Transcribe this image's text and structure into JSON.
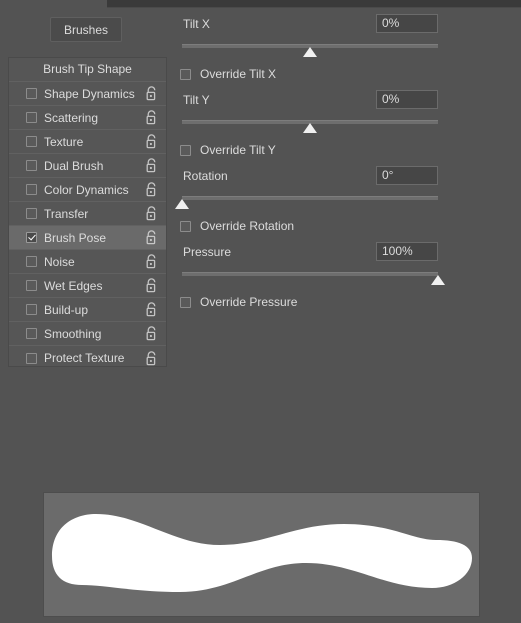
{
  "window": {
    "panel_title": "Brushes"
  },
  "toolbar": {
    "brushes_label": "Brushes"
  },
  "effect_list": {
    "header": "Brush Tip Shape",
    "items": [
      {
        "label": "Shape Dynamics",
        "checked": false,
        "selected": false,
        "lock": "unlocked"
      },
      {
        "label": "Scattering",
        "checked": false,
        "selected": false,
        "lock": "unlocked"
      },
      {
        "label": "Texture",
        "checked": false,
        "selected": false,
        "lock": "unlocked"
      },
      {
        "label": "Dual Brush",
        "checked": false,
        "selected": false,
        "lock": "unlocked"
      },
      {
        "label": "Color Dynamics",
        "checked": false,
        "selected": false,
        "lock": "unlocked"
      },
      {
        "label": "Transfer",
        "checked": false,
        "selected": false,
        "lock": "unlocked"
      },
      {
        "label": "Brush Pose",
        "checked": true,
        "selected": true,
        "lock": "unlocked"
      },
      {
        "label": "Noise",
        "checked": false,
        "selected": false,
        "lock": "unlocked"
      },
      {
        "label": "Wet Edges",
        "checked": false,
        "selected": false,
        "lock": "unlocked"
      },
      {
        "label": "Build-up",
        "checked": false,
        "selected": false,
        "lock": "unlocked"
      },
      {
        "label": "Smoothing",
        "checked": false,
        "selected": false,
        "lock": "unlocked"
      },
      {
        "label": "Protect Texture",
        "checked": false,
        "selected": false,
        "lock": "unlocked"
      }
    ]
  },
  "brush_pose": {
    "tilt_x": {
      "label": "Tilt X",
      "value": "0%",
      "slider_percent": 50,
      "override_label": "Override Tilt X",
      "override_checked": false
    },
    "tilt_y": {
      "label": "Tilt Y",
      "value": "0%",
      "slider_percent": 50,
      "override_label": "Override Tilt Y",
      "override_checked": false
    },
    "rotation": {
      "label": "Rotation",
      "value": "0°",
      "slider_percent": 0,
      "override_label": "Override Rotation",
      "override_checked": false
    },
    "pressure": {
      "label": "Pressure",
      "value": "100%",
      "slider_percent": 100,
      "override_label": "Override Pressure",
      "override_checked": false
    }
  },
  "preview": {
    "name": "brush-stroke-preview",
    "stroke_color": "#ffffff",
    "background_color": "#6b6b6b"
  },
  "colors": {
    "app_background": "#535353",
    "panel_background": "#565656",
    "selected_row": "#6a6a6a",
    "field_background": "#464646",
    "text": "#dcdcdc",
    "slider_thumb": "#f0f0f0"
  }
}
